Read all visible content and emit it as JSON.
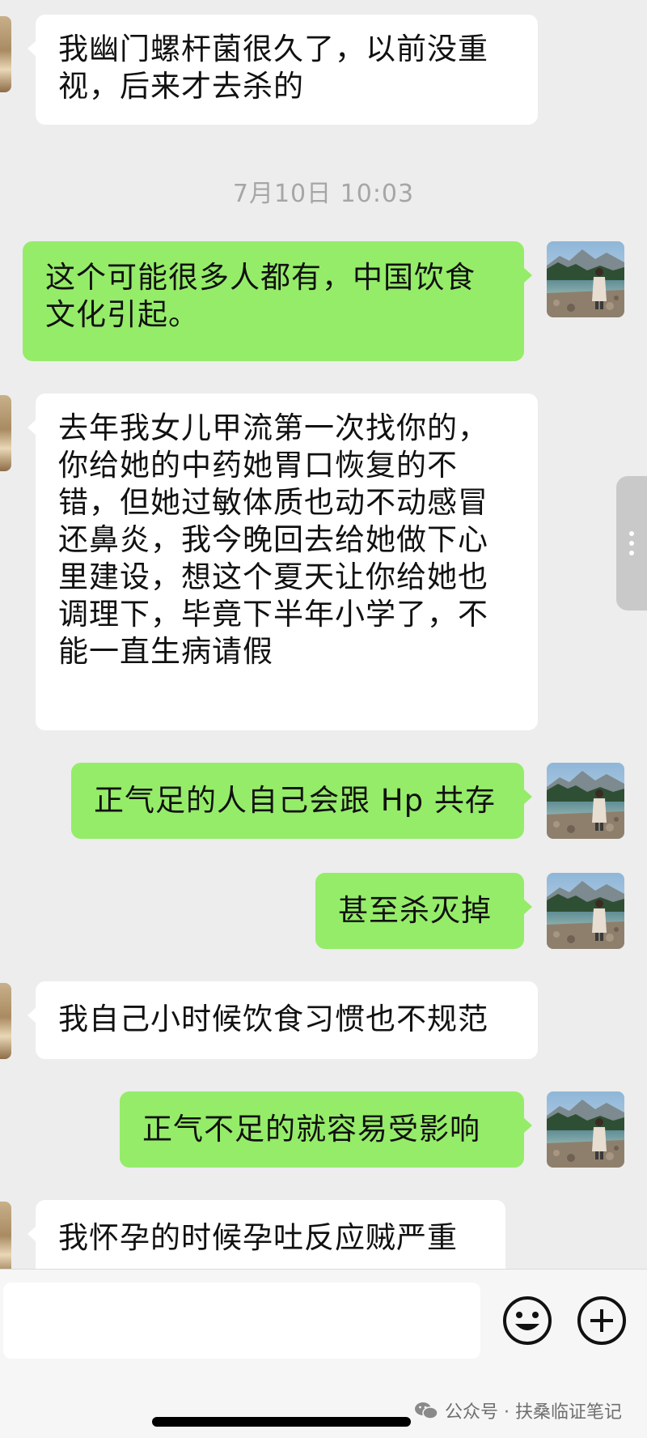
{
  "conversation": {
    "messages": [
      {
        "side": "in",
        "text": "我幽门螺杆菌很久了，以前没重\n视，后来才去杀的"
      },
      {
        "side": "out",
        "text": "这个可能很多人都有，中国饮食\n文化引起。"
      },
      {
        "side": "in",
        "text": "去年我女儿甲流第一次找你的，\n你给她的中药她胃口恢复的不\n错，但她过敏体质也动不动感冒\n还鼻炎，我今晚回去给她做下心\n里建设，想这个夏天让你给她也\n调理下，毕竟下半年小学了，不\n能一直生病请假"
      },
      {
        "side": "out",
        "text": "正气足的人自己会跟 Hp 共存"
      },
      {
        "side": "out",
        "text": "甚至杀灭掉"
      },
      {
        "side": "in",
        "text": "我自己小时候饮食习惯也不规范"
      },
      {
        "side": "out",
        "text": "正气不足的就容易受影响"
      },
      {
        "side": "in",
        "text": "我怀孕的时候孕吐反应贼严重"
      }
    ],
    "timestamp": "7月10日 10:03"
  },
  "input_bar": {
    "text_value": "",
    "emoji_icon": "emoji-icon",
    "plus_icon": "plus-icon"
  },
  "watermark": {
    "icon": "wechat-icon",
    "text": "公众号 · 扶桑临证笔记"
  },
  "colors": {
    "chat_background": "#ededed",
    "outgoing_bubble": "#95ec69",
    "incoming_bubble": "#ffffff",
    "timestamp_text": "#a6a6a6"
  }
}
